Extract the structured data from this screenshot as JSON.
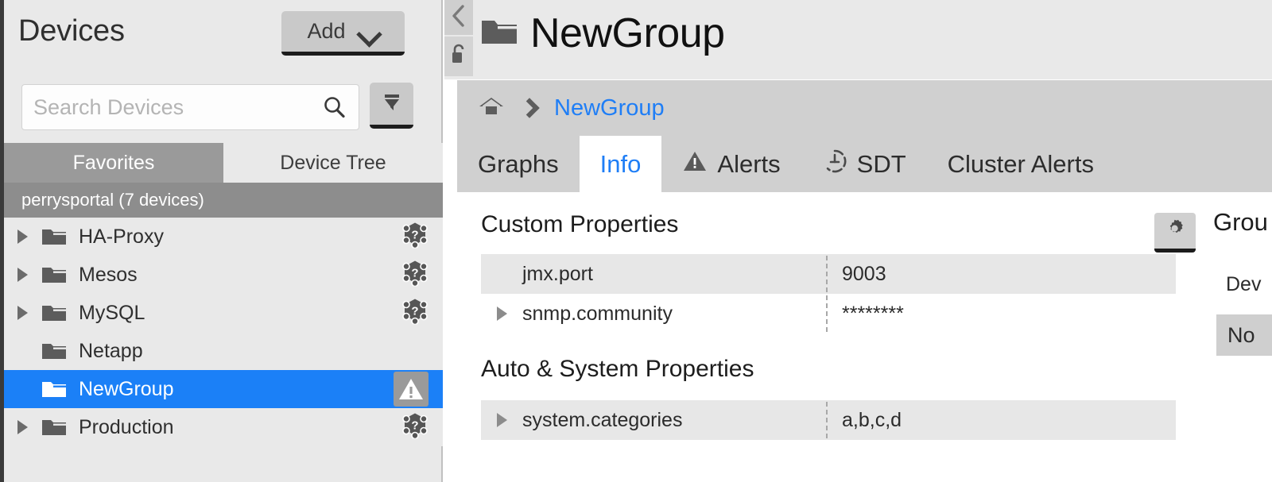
{
  "sidebar": {
    "title": "Devices",
    "add_button": {
      "label": "Add",
      "icon": "chevron-down-icon"
    },
    "search": {
      "placeholder": "Search Devices",
      "value": "",
      "icon": "search-icon"
    },
    "filter_button": {
      "icon": "funnel-icon"
    },
    "tabs": [
      {
        "label": "Favorites",
        "active": true
      },
      {
        "label": "Device Tree",
        "active": false
      }
    ],
    "group_header": "perrysportal (7 devices)",
    "tree": [
      {
        "label": "HA-Proxy",
        "expandable": true,
        "selected": false,
        "status_icon": "cluster-unknown-icon"
      },
      {
        "label": "Mesos",
        "expandable": true,
        "selected": false,
        "status_icon": "cluster-unknown-icon"
      },
      {
        "label": "MySQL",
        "expandable": true,
        "selected": false,
        "status_icon": "cluster-unknown-icon"
      },
      {
        "label": "Netapp",
        "expandable": false,
        "selected": false,
        "status_icon": ""
      },
      {
        "label": "NewGroup",
        "expandable": false,
        "selected": true,
        "status_icon": "warning-triangle-icon"
      },
      {
        "label": "Production",
        "expandable": true,
        "selected": false,
        "status_icon": "cluster-unknown-icon"
      }
    ]
  },
  "main": {
    "collapse_button": {
      "icon": "chevron-left-icon"
    },
    "lock_button": {
      "icon": "unlock-padlock-icon"
    },
    "page_title": "NewGroup",
    "page_title_icon": "folder-icon",
    "breadcrumb": {
      "home_icon": "home-icon",
      "separator_icon": "chevron-right-icon",
      "items": [
        "NewGroup"
      ]
    },
    "tabs": [
      {
        "label": "Graphs",
        "icon": "",
        "active": false
      },
      {
        "label": "Info",
        "icon": "",
        "active": true
      },
      {
        "label": "Alerts",
        "icon": "warning-triangle-icon",
        "active": false
      },
      {
        "label": "SDT",
        "icon": "sdt-clock-icon",
        "active": false
      },
      {
        "label": "Cluster Alerts",
        "icon": "",
        "active": false
      }
    ],
    "settings_button": {
      "icon": "gear-icon"
    },
    "sections": [
      {
        "title": "Custom Properties",
        "rows": [
          {
            "name": "jmx.port",
            "value": "9003",
            "expandable": false,
            "shaded": true
          },
          {
            "name": "snmp.community",
            "value": "********",
            "expandable": true,
            "shaded": false
          }
        ]
      },
      {
        "title": "Auto & System Properties",
        "rows": [
          {
            "name": "system.categories",
            "value": "a,b,c,d",
            "expandable": true,
            "shaded": true
          }
        ]
      }
    ],
    "right_panel": {
      "title": "Grou",
      "label": "Dev",
      "value_box": "No"
    }
  },
  "colors": {
    "accent_blue": "#1b80f7",
    "link_blue": "#1f7ef6",
    "sidebar_bg": "#e9e9e9",
    "tabbar_bg": "#d0d0d0",
    "group_header_bg": "#8d8d8d",
    "row_shade": "#e7e7e7"
  }
}
